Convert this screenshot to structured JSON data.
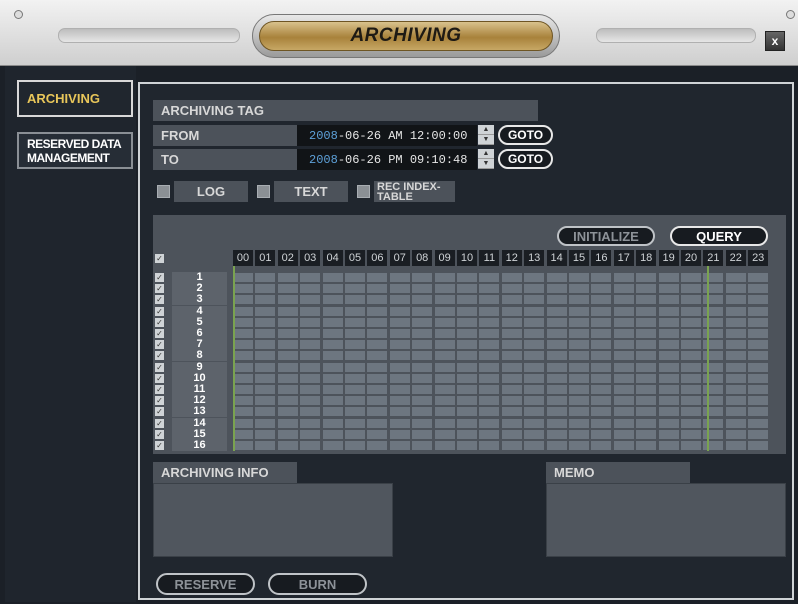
{
  "window": {
    "title": "ARCHIVING",
    "close_label": "x"
  },
  "sidebar": {
    "items": [
      {
        "label": "ARCHIVING",
        "active": true
      },
      {
        "label": "RESERVED DATA MANAGEMENT",
        "line1": "RESERVED DATA",
        "line2": "MANAGEMENT",
        "active": false
      }
    ]
  },
  "form": {
    "tag_label": "ARCHIVING TAG",
    "tag_value": "",
    "from_label": "FROM",
    "from_year": "2008",
    "from_value": "-06-26 AM 12:00:00",
    "to_label": "TO",
    "to_year": "2008",
    "to_value": "-06-26 PM 09:10:48",
    "goto_label": "GOTO"
  },
  "options": {
    "log_label": "LOG",
    "text_label": "TEXT",
    "rec_index_line1": "REC INDEX-",
    "rec_index_line2": "TABLE"
  },
  "grid": {
    "initialize_label": "INITIALIZE",
    "query_label": "QUERY",
    "hours": [
      "00",
      "01",
      "02",
      "03",
      "04",
      "05",
      "06",
      "07",
      "08",
      "09",
      "10",
      "11",
      "12",
      "13",
      "14",
      "15",
      "16",
      "17",
      "18",
      "19",
      "20",
      "21",
      "22",
      "23"
    ],
    "channels": [
      "1",
      "2",
      "3",
      "4",
      "5",
      "6",
      "7",
      "8",
      "9",
      "10",
      "11",
      "12",
      "13",
      "14",
      "15",
      "16"
    ],
    "check_mark": "✓",
    "range_start_hour": 0,
    "range_end_hour": 21.18
  },
  "archiving_info": {
    "label": "ARCHIVING INFO"
  },
  "memo": {
    "label": "MEMO"
  },
  "actions": {
    "reserve_label": "RESERVE",
    "burn_label": "BURN"
  },
  "colors": {
    "accent": "#e8c65a",
    "year": "#5da0d8",
    "timeline_marker": "#7aa350"
  }
}
